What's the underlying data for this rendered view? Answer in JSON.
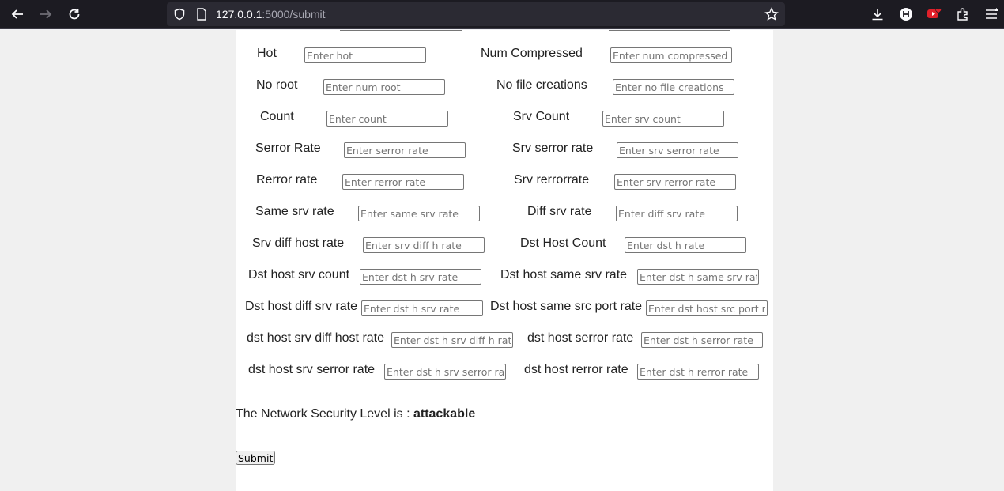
{
  "browser": {
    "url_host": "127.0.0.1",
    "url_rest": ":5000/submit"
  },
  "form": {
    "rows": [
      {
        "l1": "Hot",
        "p1": "Enter hot",
        "l2": "Num Compressed",
        "p2": "Enter num compressed"
      },
      {
        "l1": "No root",
        "p1": "Enter num root",
        "l2": "No file creations",
        "p2": "Enter no file creations"
      },
      {
        "l1": "Count",
        "p1": "Enter count",
        "l2": "Srv Count",
        "p2": "Enter srv count"
      },
      {
        "l1": "Serror Rate",
        "p1": "Enter serror rate",
        "l2": "Srv serror rate",
        "p2": "Enter srv serror rate"
      },
      {
        "l1": "Rerror rate",
        "p1": "Enter rerror rate",
        "l2": "Srv rerrorrate",
        "p2": "Enter srv rerror rate"
      },
      {
        "l1": "Same srv rate",
        "p1": "Enter same srv rate",
        "l2": "Diff srv rate",
        "p2": "Enter diff srv rate"
      },
      {
        "l1": "Srv diff host rate",
        "p1": "Enter srv diff h rate",
        "l2": "Dst Host Count",
        "p2": "Enter dst h rate"
      },
      {
        "l1": "Dst host srv count",
        "p1": "Enter dst h srv rate",
        "l2": "Dst host same srv rate",
        "p2": "Enter dst h same srv rate"
      },
      {
        "l1": "Dst host diff srv rate",
        "p1": "Enter dst h srv rate",
        "l2": "Dst host same src port rate",
        "p2": "Enter dst host src port rate"
      },
      {
        "l1": "dst host srv diff host rate",
        "p1": "Enter dst h srv diff h rate",
        "l2": "dst host serror rate",
        "p2": "Enter dst h serror rate"
      },
      {
        "l1": "dst host srv serror rate",
        "p1": "Enter dst h srv serror rate",
        "l2": "dst host rerror rate",
        "p2": "Enter dst h rerror rate"
      }
    ]
  },
  "result": {
    "prefix": "The Network Security Level is : ",
    "value": "attackable"
  },
  "submit_label": "Submit"
}
